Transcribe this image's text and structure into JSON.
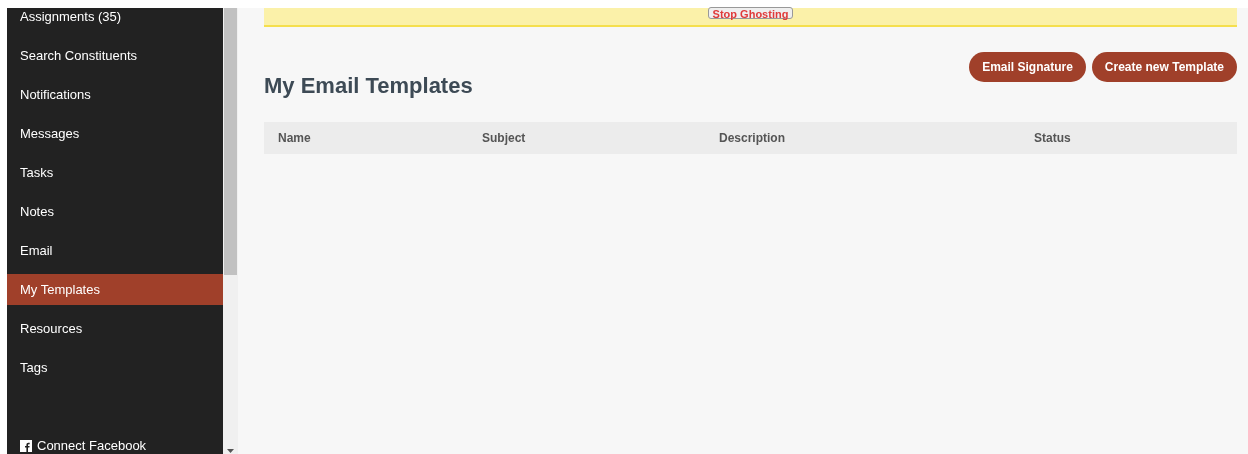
{
  "sidebar": {
    "items": [
      {
        "label": "Assignments (35)",
        "selected": false
      },
      {
        "label": "Search Constituents",
        "selected": false
      },
      {
        "label": "Notifications",
        "selected": false
      },
      {
        "label": "Messages",
        "selected": false
      },
      {
        "label": "Tasks",
        "selected": false
      },
      {
        "label": "Notes",
        "selected": false
      },
      {
        "label": "Email",
        "selected": false
      },
      {
        "label": "My Templates",
        "selected": true
      },
      {
        "label": "Resources",
        "selected": false
      },
      {
        "label": "Tags",
        "selected": false
      }
    ],
    "footer_link": "Connect Facebook"
  },
  "banner": {
    "button": "Stop Ghosting"
  },
  "page": {
    "title": "My Email Templates",
    "buttons": [
      "Email Signature",
      "Create new Template"
    ]
  },
  "table": {
    "columns": [
      "Name",
      "Subject",
      "Description",
      "Status"
    ]
  }
}
